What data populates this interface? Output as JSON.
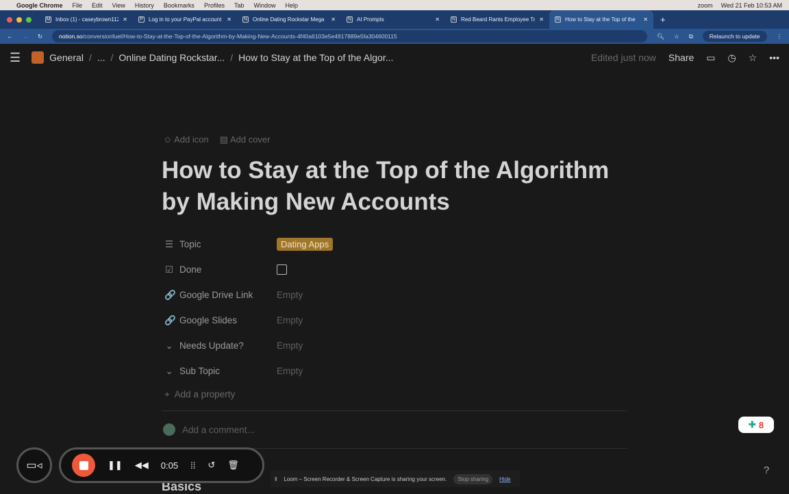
{
  "menubar": {
    "app": "Google Chrome",
    "items": [
      "File",
      "Edit",
      "View",
      "History",
      "Bookmarks",
      "Profiles",
      "Tab",
      "Window",
      "Help"
    ],
    "zoom": "zoom",
    "clock": "Wed 21 Feb  10:53 AM"
  },
  "tabs": [
    {
      "label": "Inbox (1) - caseybrown112@g"
    },
    {
      "label": "Log in to your PayPal account"
    },
    {
      "label": "Online Dating Rockstar Mega"
    },
    {
      "label": "AI Prompts"
    },
    {
      "label": "Red Beard Rants Employee Tr"
    },
    {
      "label": "How to Stay at the Top of the"
    }
  ],
  "address": {
    "domain": "notion.so",
    "path": "/conversionfuel/How-to-Stay-at-the-Top-of-the-Algorithm-by-Making-New-Accounts-4f40a6103e5e4917889e5fa304600115",
    "relaunch": "Relaunch to update"
  },
  "topbar": {
    "crumbs": [
      "General",
      "...",
      "Online Dating Rockstar...",
      "How to Stay at the Top of the Algor..."
    ],
    "edited": "Edited just now",
    "share": "Share"
  },
  "page": {
    "add_icon": "Add icon",
    "add_cover": "Add cover",
    "title": "How to Stay at the Top of the Algorithm by Making New Accounts",
    "props": [
      {
        "icon": "☰",
        "key": "Topic",
        "value": "Dating Apps"
      },
      {
        "icon": "☑",
        "key": "Done",
        "value": ""
      },
      {
        "icon": "🔗",
        "key": "Google Drive Link",
        "value": "Empty"
      },
      {
        "icon": "🔗",
        "key": "Google Slides",
        "value": "Empty"
      },
      {
        "icon": "⌄",
        "key": "Needs Update?",
        "value": "Empty"
      },
      {
        "icon": "⌄",
        "key": "Sub Topic",
        "value": "Empty"
      }
    ],
    "add_property": "Add a property",
    "add_comment": "Add a comment...",
    "heading": "Basics",
    "tag_color": "#a07628"
  },
  "loom": {
    "time": "0:05",
    "sharing": "Loom – Screen Recorder & Screen Capture is sharing your screen.",
    "stop": "Stop sharing",
    "hide": "Hide",
    "badge": "8"
  }
}
